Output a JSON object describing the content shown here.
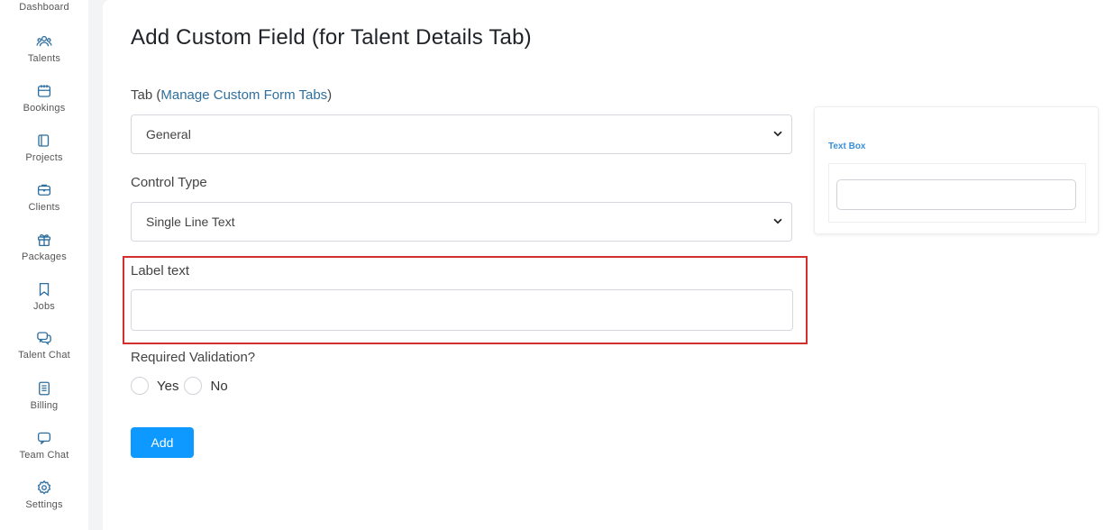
{
  "sidebar": {
    "items": [
      {
        "label": "Dashboard",
        "icon": "dashboard-icon"
      },
      {
        "label": "Talents",
        "icon": "users-icon"
      },
      {
        "label": "Bookings",
        "icon": "calendar-icon"
      },
      {
        "label": "Projects",
        "icon": "projects-icon"
      },
      {
        "label": "Clients",
        "icon": "briefcase-icon"
      },
      {
        "label": "Packages",
        "icon": "gift-icon"
      },
      {
        "label": "Jobs",
        "icon": "bookmark-icon"
      },
      {
        "label": "Talent Chat",
        "icon": "chat-bubbles-icon"
      },
      {
        "label": "Billing",
        "icon": "document-icon"
      },
      {
        "label": "Team Chat",
        "icon": "chat-icon"
      },
      {
        "label": "Settings",
        "icon": "gear-icon"
      }
    ],
    "icon_color": "#2f6fa0"
  },
  "main": {
    "title": "Add Custom Field (for Talent Details Tab)",
    "tab_field": {
      "label_prefix": "Tab (",
      "link_text": "Manage Custom Form Tabs",
      "label_suffix": ")",
      "selected": "General"
    },
    "control_type_field": {
      "label": "Control Type",
      "selected": "Single Line Text"
    },
    "label_text_field": {
      "label": "Label text",
      "value": "",
      "placeholder": ""
    },
    "required_validation": {
      "label": "Required Validation?",
      "options": [
        "Yes",
        "No"
      ],
      "selected": null
    },
    "add_button": "Add"
  },
  "preview": {
    "label": "Text Box",
    "value": ""
  },
  "colors": {
    "accent": "#0d99ff",
    "link": "#2f6fa0",
    "highlight_border": "#d32f2f",
    "preview_label": "#3b8fd9"
  }
}
